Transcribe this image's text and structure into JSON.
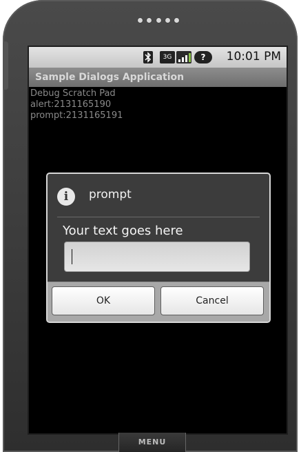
{
  "statusbar": {
    "clock": "10:01 PM",
    "icons": [
      "bluetooth-icon",
      "3g-icon",
      "signal-icon",
      "battery-unknown-icon"
    ]
  },
  "app": {
    "title": "Sample Dialogs Application"
  },
  "scratchpad": {
    "heading": "Debug Scratch Pad",
    "lines": [
      "alert:2131165190",
      "prompt:2131165191"
    ]
  },
  "dialog": {
    "title": "prompt",
    "message": "Your text goes here",
    "input_value": "",
    "ok_label": "OK",
    "cancel_label": "Cancel"
  },
  "phone": {
    "menu_label": "MENU"
  }
}
